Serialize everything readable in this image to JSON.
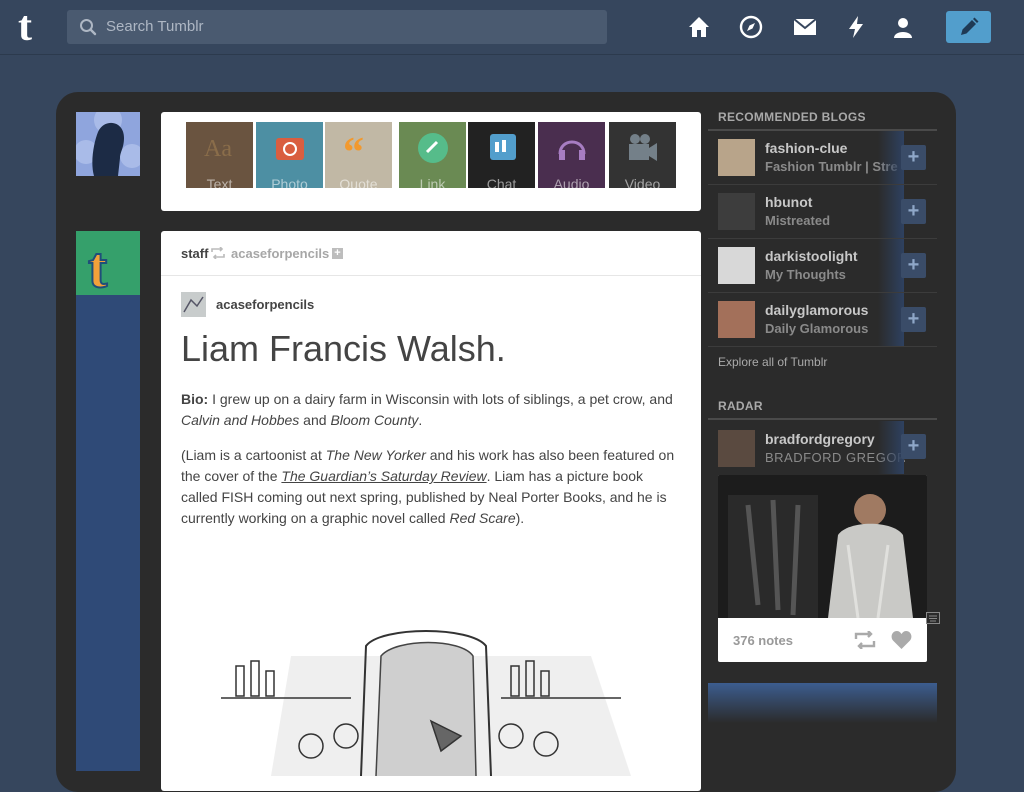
{
  "header": {
    "logo": "t",
    "search_placeholder": "Search Tumblr"
  },
  "post_types": [
    {
      "label": "Text",
      "color": "#8a6d4a"
    },
    {
      "label": "Photo",
      "color": "#d95e40"
    },
    {
      "label": "Quote",
      "color": "#f2992e"
    },
    {
      "label": "Link",
      "color": "#56bc8a"
    },
    {
      "label": "Chat",
      "color": "#529ecc"
    },
    {
      "label": "Audio",
      "color": "#a77dc2"
    },
    {
      "label": "Video",
      "color": "#748089"
    }
  ],
  "post": {
    "reblogger": "staff",
    "source": "acaseforpencils",
    "plus": "+",
    "author": "acaseforpencils",
    "title": "Liam Francis Walsh.",
    "bio_label": "Bio:",
    "bio_text": " I grew up on a dairy farm in Wisconsin with lots of siblings, a pet crow, and ",
    "bio_em1": "Calvin and Hobbes",
    "bio_and": " and ",
    "bio_em2": "Bloom County",
    "bio_end": ".",
    "p2_a": "(Liam is a cartoonist at ",
    "p2_em1": "The New Yorker",
    "p2_b": " and his work has also been featured on the cover of the ",
    "p2_link": "The Guardian’s Saturday Review",
    "p2_c": ". Liam has a picture book called FISH coming out next spring, published by Neal Porter Books, and he is currently working on a graphic novel called ",
    "p2_em2": "Red Scare",
    "p2_d": ")."
  },
  "sidebar": {
    "recommended_heading": "RECOMMENDED BLOGS",
    "blogs": [
      {
        "name": "fashion-clue",
        "subtitle": "Fashion Tumblr | Stre"
      },
      {
        "name": "hbunot",
        "subtitle": "Mistreated"
      },
      {
        "name": "darkistoolight",
        "subtitle": "My Thoughts"
      },
      {
        "name": "dailyglamorous",
        "subtitle": "Daily Glamorous"
      }
    ],
    "follow_symbol": "+",
    "explore": "Explore all of Tumblr",
    "radar_heading": "RADAR",
    "radar_blog": {
      "name": "bradfordgregory",
      "subtitle": "BRADFORD GREGOR"
    },
    "radar_notes": "376 notes"
  },
  "colors": {
    "background": "#36465d",
    "dashboard": "#2b2b2b",
    "accent": "#529ecc"
  }
}
